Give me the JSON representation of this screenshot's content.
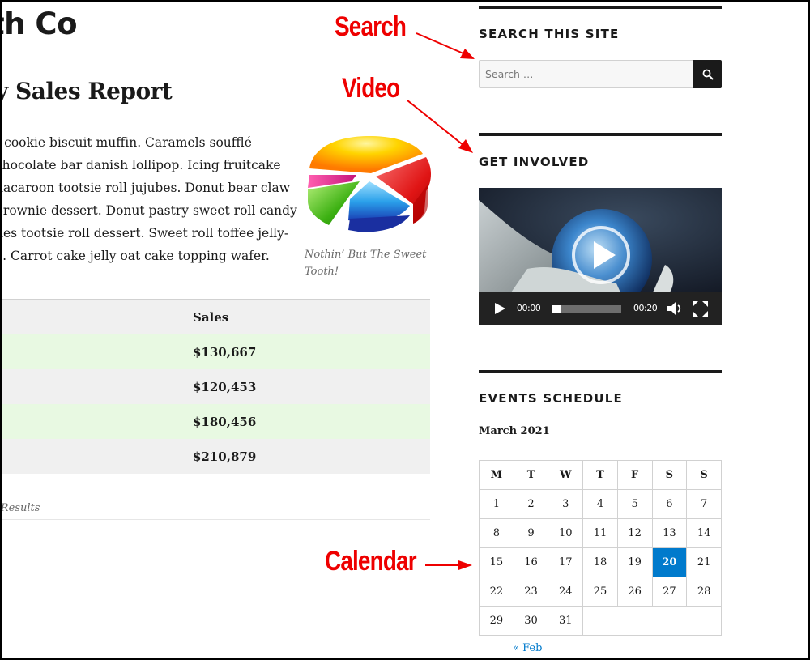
{
  "header": {
    "site_title": "th Co",
    "page_title": "y Sales Report"
  },
  "article": {
    "paragraph_lines": [
      "t cookie biscuit muffin. Caramels soufflé",
      " chocolate bar danish lollipop. Icing fruitcake",
      "nacaroon tootsie roll jujubes. Donut bear claw",
      "prownie dessert. Donut pastry sweet roll candy",
      "nes tootsie roll dessert. Sweet roll toffee jelly-",
      "e. Carrot cake jelly oat cake topping wafer."
    ],
    "figure": {
      "image": "3d-pie-chart-image",
      "caption_line1": "Nothin’ But The Sweet",
      "caption_line2": "Tooth!"
    }
  },
  "sales_table": {
    "header": "Sales",
    "rows": [
      "$130,667",
      "$120,453",
      "$180,456",
      "$210,879"
    ],
    "row_colors": [
      "#e8f9e2",
      "#f0f0f0",
      "#e8f9e2",
      "#f0f0f0"
    ],
    "caption": "s Results"
  },
  "annotations": {
    "search": "Search",
    "video": "Video",
    "calendar": "Calendar",
    "color": "#ee0000"
  },
  "sidebar": {
    "search_widget": {
      "title": "SEARCH THIS SITE",
      "placeholder": "Search …",
      "button_icon": "search-icon"
    },
    "video_widget": {
      "title": "GET INVOLVED",
      "current_time": "00:00",
      "duration": "00:20",
      "progress_percent": 12
    },
    "events_widget": {
      "title": "EVENTS SCHEDULE",
      "month": "March 2021",
      "weekdays": [
        "M",
        "T",
        "W",
        "T",
        "F",
        "S",
        "S"
      ],
      "weeks": [
        [
          "1",
          "2",
          "3",
          "4",
          "5",
          "6",
          "7"
        ],
        [
          "8",
          "9",
          "10",
          "11",
          "12",
          "13",
          "14"
        ],
        [
          "15",
          "16",
          "17",
          "18",
          "19",
          "20",
          "21"
        ],
        [
          "22",
          "23",
          "24",
          "25",
          "26",
          "27",
          "28"
        ],
        [
          "29",
          "30",
          "31"
        ]
      ],
      "today": "20",
      "today_color": "#007acc",
      "prev_link": "« Feb"
    }
  }
}
